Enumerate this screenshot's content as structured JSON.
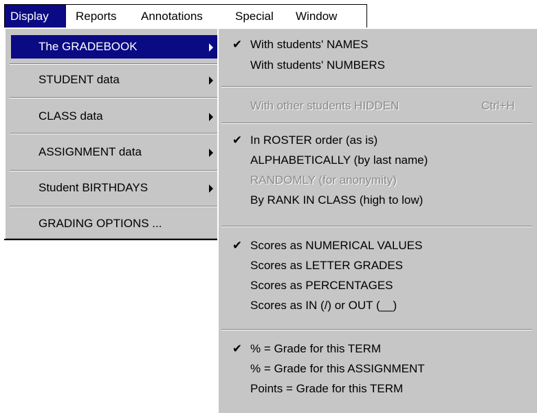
{
  "menubar": {
    "items": [
      "Display",
      "Reports",
      "Annotations",
      "Special",
      "Window"
    ]
  },
  "main_menu": {
    "items": [
      {
        "label": "The GRADEBOOK"
      },
      {
        "label": "STUDENT data"
      },
      {
        "label": "CLASS data"
      },
      {
        "label": "ASSIGNMENT data"
      },
      {
        "label": "Student BIRTHDAYS"
      },
      {
        "label": "GRADING OPTIONS ..."
      }
    ]
  },
  "sub_menu": {
    "items": [
      {
        "label": "With students' NAMES",
        "checked": true
      },
      {
        "label": "With students' NUMBERS",
        "checked": false
      },
      {
        "label": "With other students HIDDEN",
        "shortcut": "Ctrl+H",
        "disabled": true
      },
      {
        "label": "In ROSTER order (as is)",
        "checked": true
      },
      {
        "label": "ALPHABETICALLY (by last name)",
        "checked": false
      },
      {
        "label": "RANDOMLY (for anonymity)",
        "disabled": true
      },
      {
        "label": "By RANK IN CLASS (high to low)",
        "checked": false
      },
      {
        "label": "Scores as NUMERICAL VALUES",
        "checked": true
      },
      {
        "label": "Scores as LETTER GRADES",
        "checked": false
      },
      {
        "label": "Scores as PERCENTAGES",
        "checked": false
      },
      {
        "label": "Scores as IN (/) or OUT (__)",
        "checked": false
      },
      {
        "label": "% = Grade for this TERM",
        "checked": true
      },
      {
        "label": "% = Grade for this ASSIGNMENT",
        "checked": false
      },
      {
        "label": "Points = Grade for this TERM",
        "checked": false
      }
    ],
    "check_glyph": "✔"
  },
  "colors": {
    "highlight": "#0a0a84",
    "menu_face": "#c6c6c6",
    "disabled_text": "#8a8a8a"
  }
}
